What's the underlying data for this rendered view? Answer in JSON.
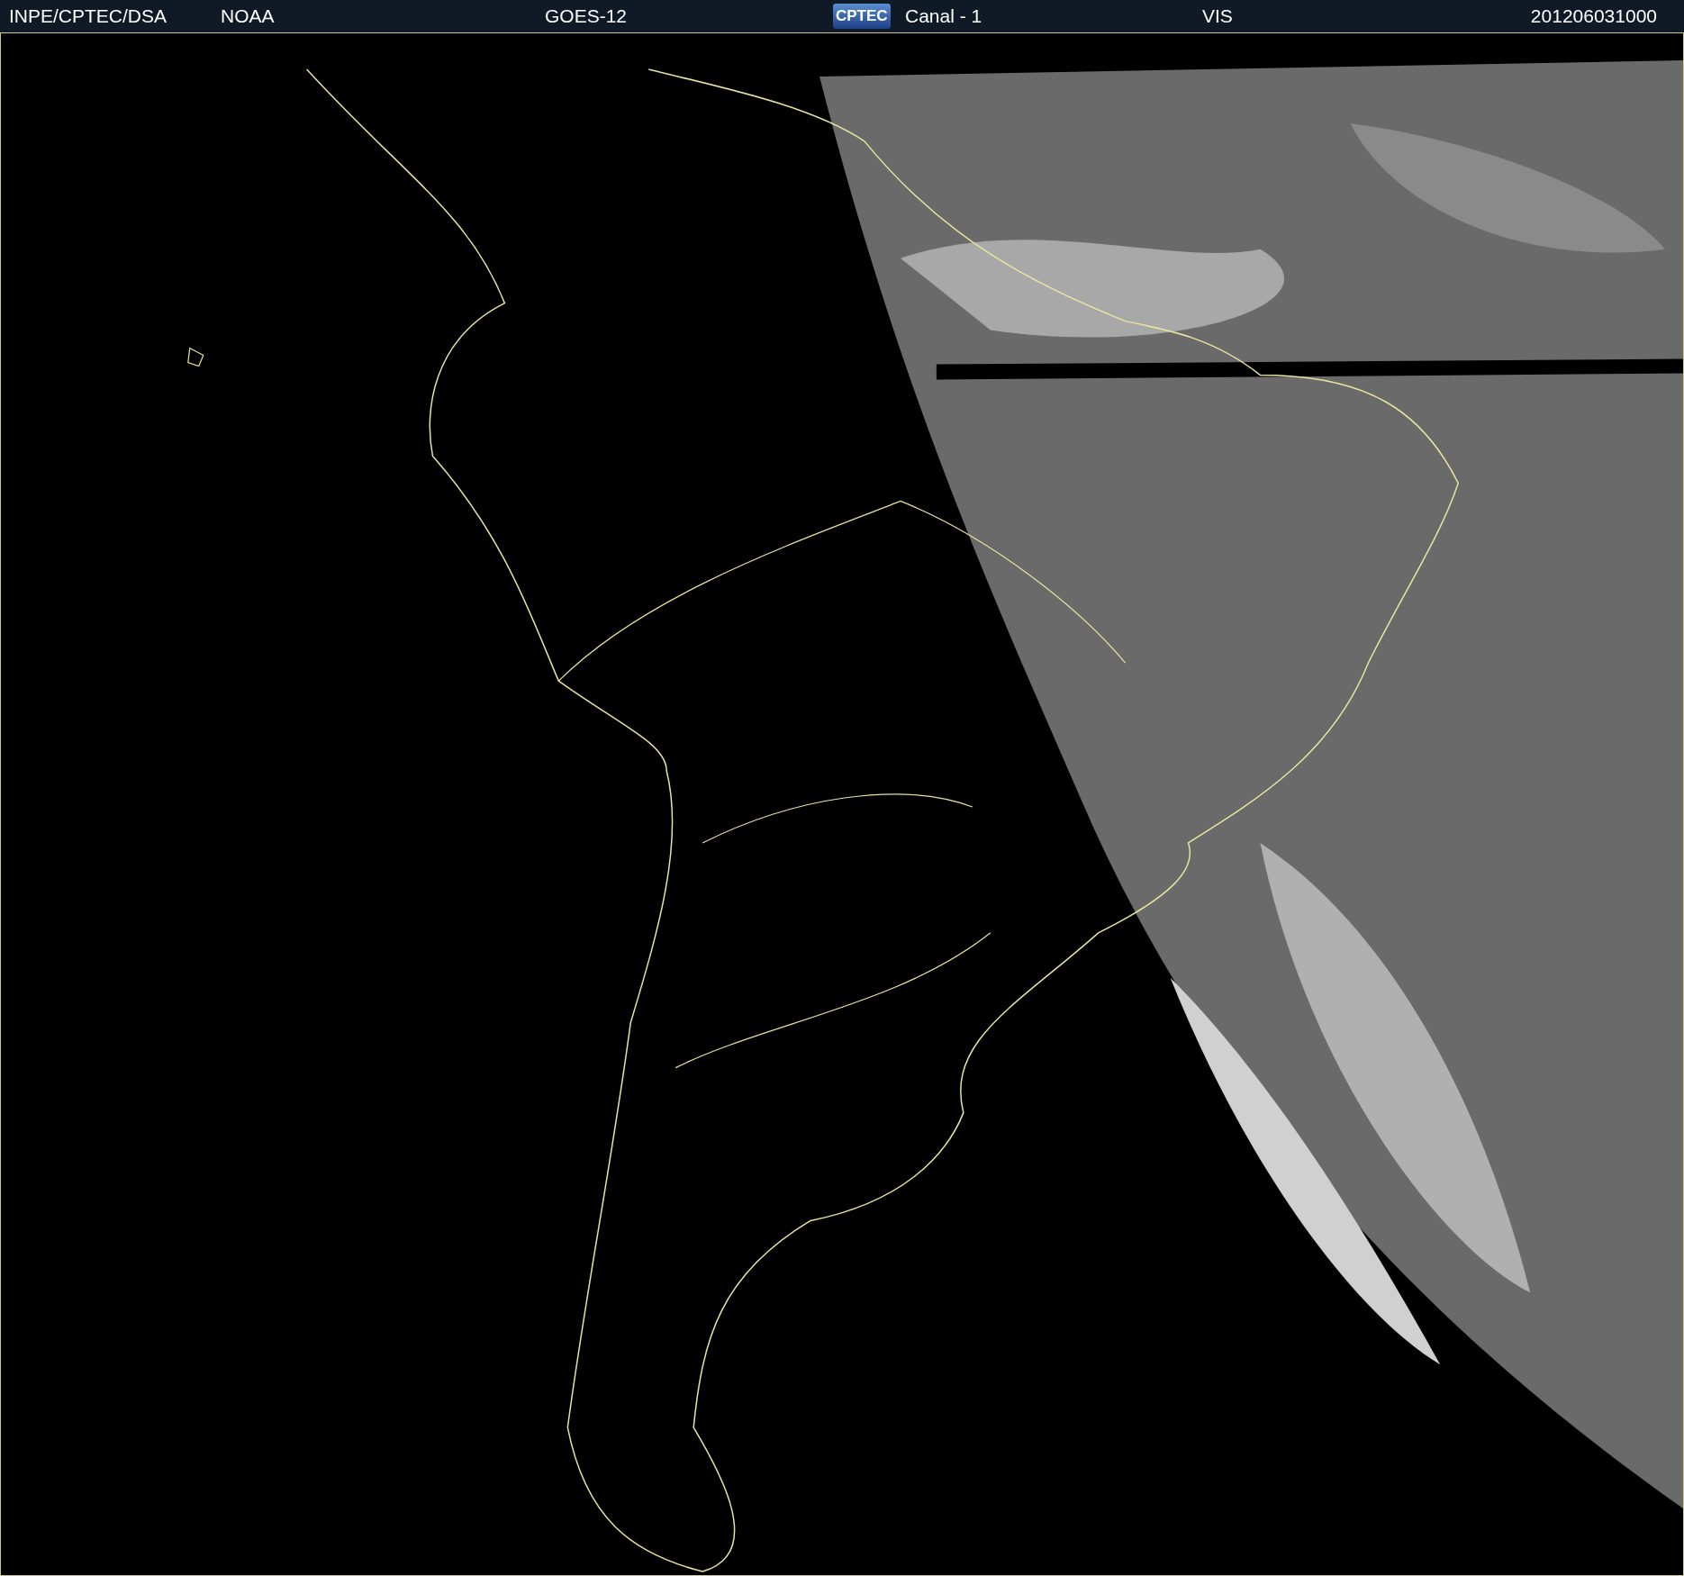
{
  "header": {
    "source": "INPE/CPTEC/DSA",
    "agency": "NOAA",
    "satellite": "GOES-12",
    "logo": "CPTEC",
    "channel": "Canal - 1",
    "band": "VIS",
    "timestamp": "201206031000"
  }
}
